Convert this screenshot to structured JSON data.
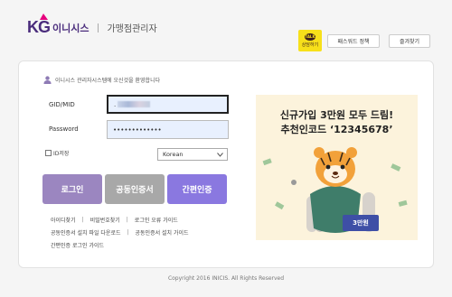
{
  "header": {
    "logo_kg": "KG",
    "logo_brand": "이니시스",
    "logo_sub": "가맹점관리자",
    "kakao_label": "상담하기",
    "kakao_bubble": "TALK",
    "password_policy": "패스워드 정책",
    "bookmark": "즐겨찾기"
  },
  "login": {
    "welcome": "이니시스 관리자시스템에 오신것을 환영합니다",
    "id_label": "GID/MID",
    "id_value": ".",
    "pw_label": "Password",
    "pw_value": "•••••••••••••",
    "save_id": "ID저장",
    "language": "Korean",
    "login_btn": "로그인",
    "cert_btn": "공동인증서",
    "easy_btn": "간편인증"
  },
  "links": {
    "row1": [
      "아이디찾기",
      "비밀번호찾기",
      "로그인 오류 가이드"
    ],
    "row2": [
      "공동인증서 설치 파일 다운로드",
      "공동인증서 설치 가이드"
    ],
    "row3": [
      "간편인증 로그인 가이드"
    ]
  },
  "banner": {
    "line1": "신규가입 3만원 모두 드림!",
    "line2": "추천인코드 ‘12345678’",
    "badge": "3만원"
  },
  "colors": {
    "login": "#9b86c0",
    "cert": "#a8a8a8",
    "easy": "#8a78e0",
    "kakao": "#f7e01a"
  },
  "footer": {
    "copyright": "Copyright 2016 INICIS. All Rights Reserved"
  }
}
